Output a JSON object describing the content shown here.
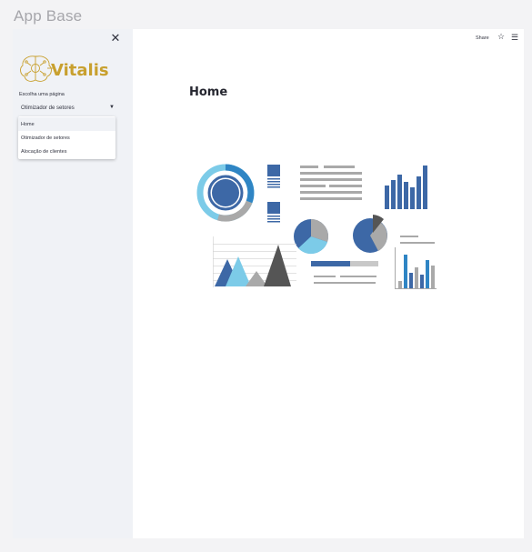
{
  "app": {
    "title": "App Base"
  },
  "sidebar": {
    "close_icon": "close-icon",
    "logo_text": "Vitalis",
    "logo_icon": "brain-circuit-icon",
    "select": {
      "label": "Escolha uma página",
      "value": "Otimizador de setores",
      "options": [
        "Home",
        "Otimizador de setores",
        "Alocação de clientes"
      ]
    }
  },
  "topbar": {
    "share_label": "Share",
    "star_icon": "star-icon",
    "menu_icon": "hamburger-menu-icon"
  },
  "main": {
    "title": "Home",
    "illustration": "dashboard-charts-illustration"
  },
  "colors": {
    "accent_gold": "#c8a02e",
    "dark_blue": "#3d68a6",
    "mid_blue": "#2f85c4",
    "light_blue": "#7ccbe8",
    "gray": "#a9a9a9",
    "dark_gray": "#555555"
  }
}
